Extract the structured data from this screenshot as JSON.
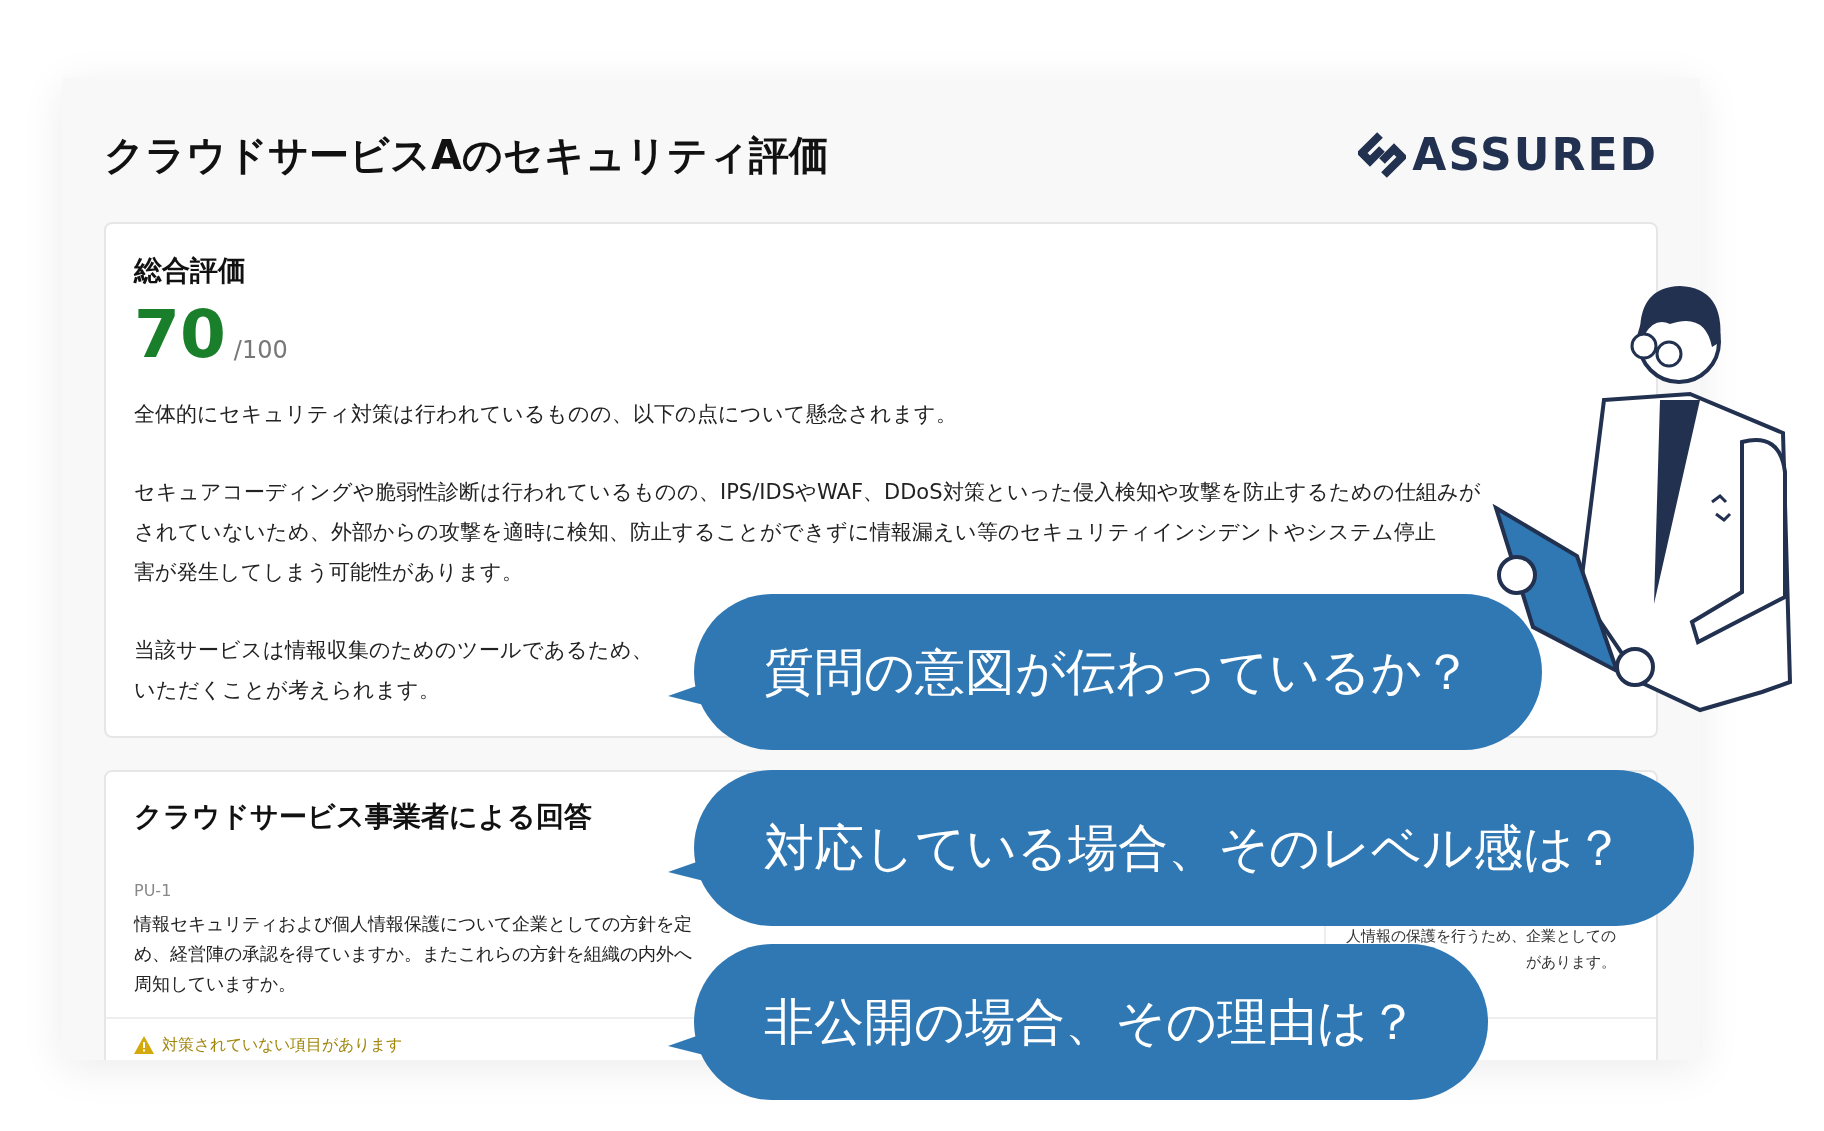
{
  "header": {
    "title": "クラウドサービスAのセキュリティ評価",
    "logo_text": "ASSURED"
  },
  "overall": {
    "heading": "総合評価",
    "score": "70",
    "max": "/100",
    "paragraphs": [
      [
        "全体的にセキュリティ対策は行われているものの、以下の点について懸念されます。"
      ],
      [
        "セキュアコーディングや脆弱性診断は行われているものの、IPS/IDSやWAF、DDoS対策といった侵入検知や攻撃を防止するための仕組みが",
        "されていないため、外部からの攻撃を適時に検知、防止することができずに情報漏えい等のセキュリティインシデントやシステム停止",
        "害が発生してしまう可能性があります。"
      ],
      [
        "当該サービスは情報収集のためのツールであるため、",
        "いただくことが考えられます。"
      ]
    ]
  },
  "answers": {
    "heading": "クラウドサービス事業者による回答",
    "code": "PU-1",
    "question": "情報セキュリティおよび個人情報保護について企業としての方針を定め、経営陣の承認を得ていますか。またこれらの方針を組織の内外へ周知していますか。",
    "note_lines": [
      "人情報の保護を行うため、企業としての",
      "があります。"
    ],
    "warning": "対策されていない項目があります"
  },
  "bubbles": [
    "質問の意図が伝わっているか？",
    "対応している場合、そのレベル感は？",
    "非公開の場合、その理由は？"
  ]
}
